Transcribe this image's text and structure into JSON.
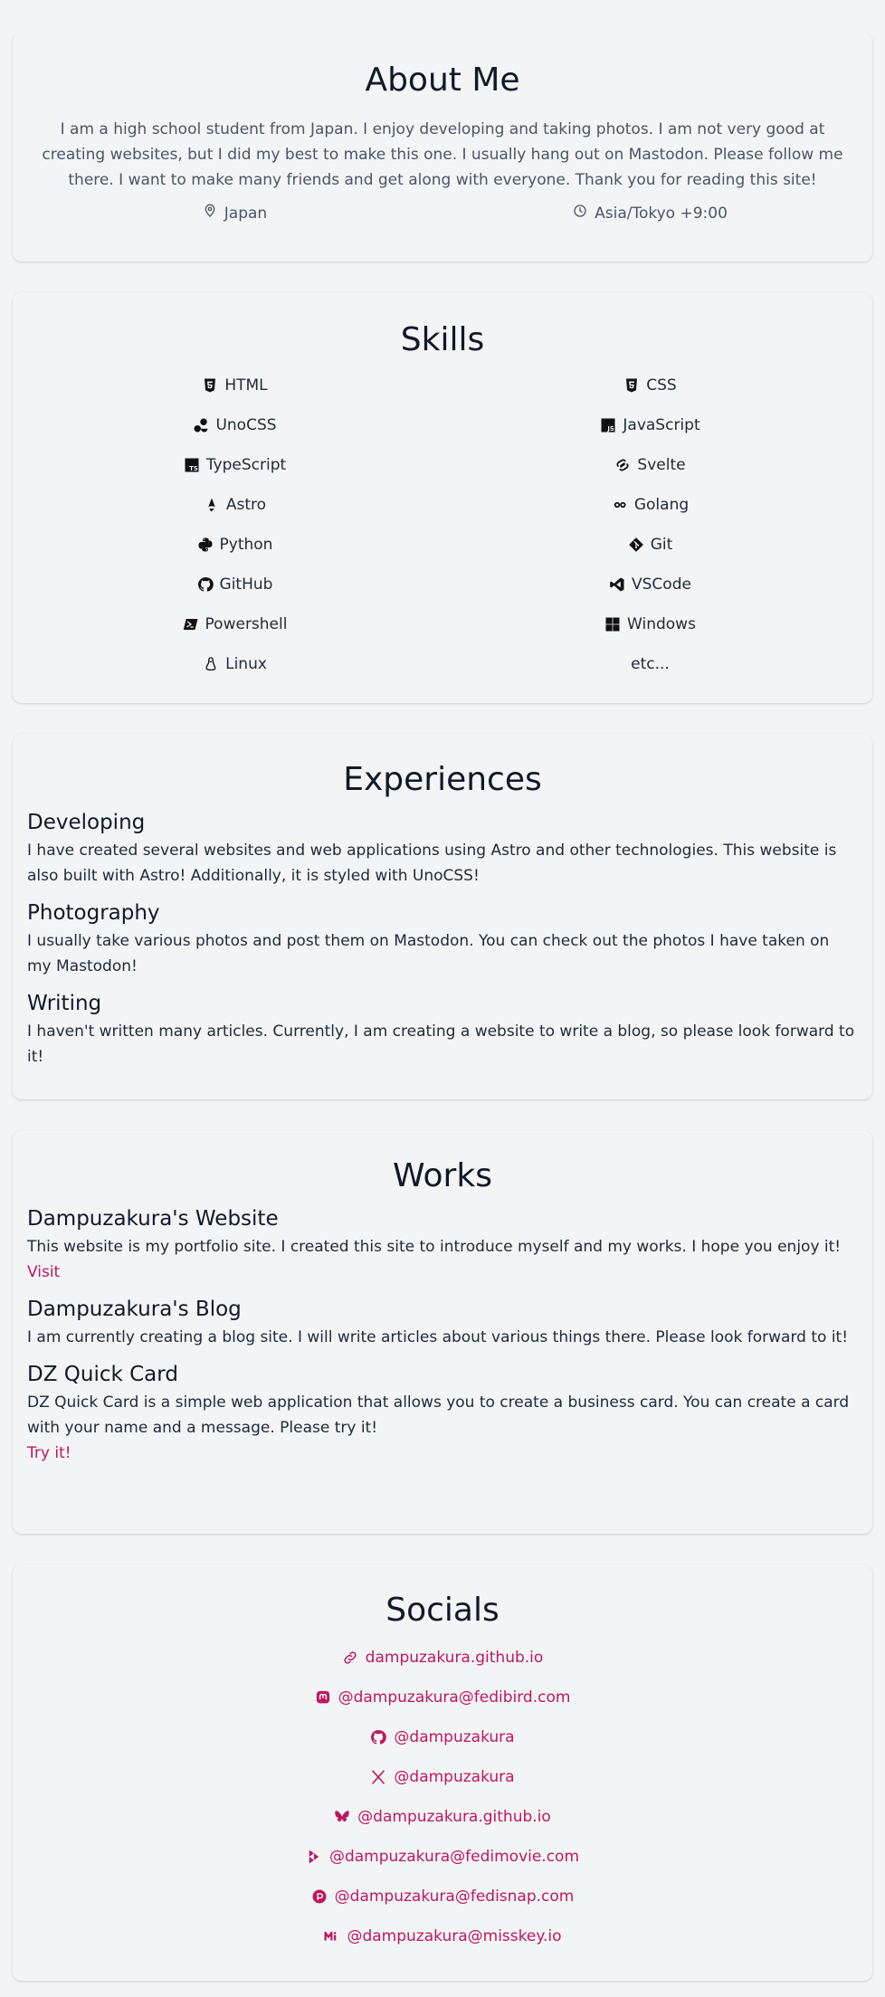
{
  "about": {
    "title": "About Me",
    "bio": "I am a high school student from Japan. I enjoy developing and taking photos. I am not very good at creating websites, but I did my best to make this one. I usually hang out on Mastodon. Please follow me there. I want to make many friends and get along with everyone. Thank you for reading this site!",
    "location": "Japan",
    "location_icon": "map-pin-icon",
    "timezone": "Asia/Tokyo +9:00",
    "timezone_icon": "clock-icon"
  },
  "skills": {
    "title": "Skills",
    "items": [
      {
        "label": "HTML",
        "icon": "html5-icon"
      },
      {
        "label": "CSS",
        "icon": "css3-icon"
      },
      {
        "label": "UnoCSS",
        "icon": "unocss-icon"
      },
      {
        "label": "JavaScript",
        "icon": "javascript-icon"
      },
      {
        "label": "TypeScript",
        "icon": "typescript-icon"
      },
      {
        "label": "Svelte",
        "icon": "svelte-icon"
      },
      {
        "label": "Astro",
        "icon": "astro-icon"
      },
      {
        "label": "Golang",
        "icon": "golang-icon"
      },
      {
        "label": "Python",
        "icon": "python-icon"
      },
      {
        "label": "Git",
        "icon": "git-icon"
      },
      {
        "label": "GitHub",
        "icon": "github-icon"
      },
      {
        "label": "VSCode",
        "icon": "vscode-icon"
      },
      {
        "label": "Powershell",
        "icon": "powershell-icon"
      },
      {
        "label": "Windows",
        "icon": "windows-icon"
      },
      {
        "label": "Linux",
        "icon": "linux-icon"
      },
      {
        "label": "etc...",
        "icon": ""
      }
    ]
  },
  "experiences": {
    "title": "Experiences",
    "items": [
      {
        "title": "Developing",
        "text": "I have created several websites and web applications using Astro and other technologies. This website is also built with Astro! Additionally, it is styled with UnoCSS!"
      },
      {
        "title": "Photography",
        "text": "I usually take various photos and post them on Mastodon. You can check out the photos I have taken on my Mastodon!"
      },
      {
        "title": "Writing",
        "text": "I haven't written many articles. Currently, I am creating a website to write a blog, so please look forward to it!"
      }
    ]
  },
  "works": {
    "title": "Works",
    "items": [
      {
        "title": "Dampuzakura's Website",
        "text": "This website is my portfolio site. I created this site to introduce myself and my works. I hope you enjoy it!",
        "link": "Visit"
      },
      {
        "title": "Dampuzakura's Blog",
        "text": "I am currently creating a blog site. I will write articles about various things there. Please look forward to it!"
      },
      {
        "title": "DZ Quick Card",
        "text": "DZ Quick Card is a simple web application that allows you to create a business card. You can create a card with your name and a message. Please try it!",
        "link": "Try it!"
      }
    ]
  },
  "socials": {
    "title": "Socials",
    "accent": "#be185d",
    "items": [
      {
        "label": "dampuzakura.github.io",
        "icon": "link-icon"
      },
      {
        "label": "@dampuzakura@fedibird.com",
        "icon": "mastodon-icon"
      },
      {
        "label": "@dampuzakura",
        "icon": "github-icon"
      },
      {
        "label": "@dampuzakura",
        "icon": "x-icon"
      },
      {
        "label": "@dampuzakura.github.io",
        "icon": "bluesky-icon"
      },
      {
        "label": "@dampuzakura@fedimovie.com",
        "icon": "peertube-icon"
      },
      {
        "label": "@dampuzakura@fedisnap.com",
        "icon": "pixelfed-icon"
      },
      {
        "label": "@dampuzakura@misskey.io",
        "icon": "misskey-icon"
      }
    ]
  }
}
